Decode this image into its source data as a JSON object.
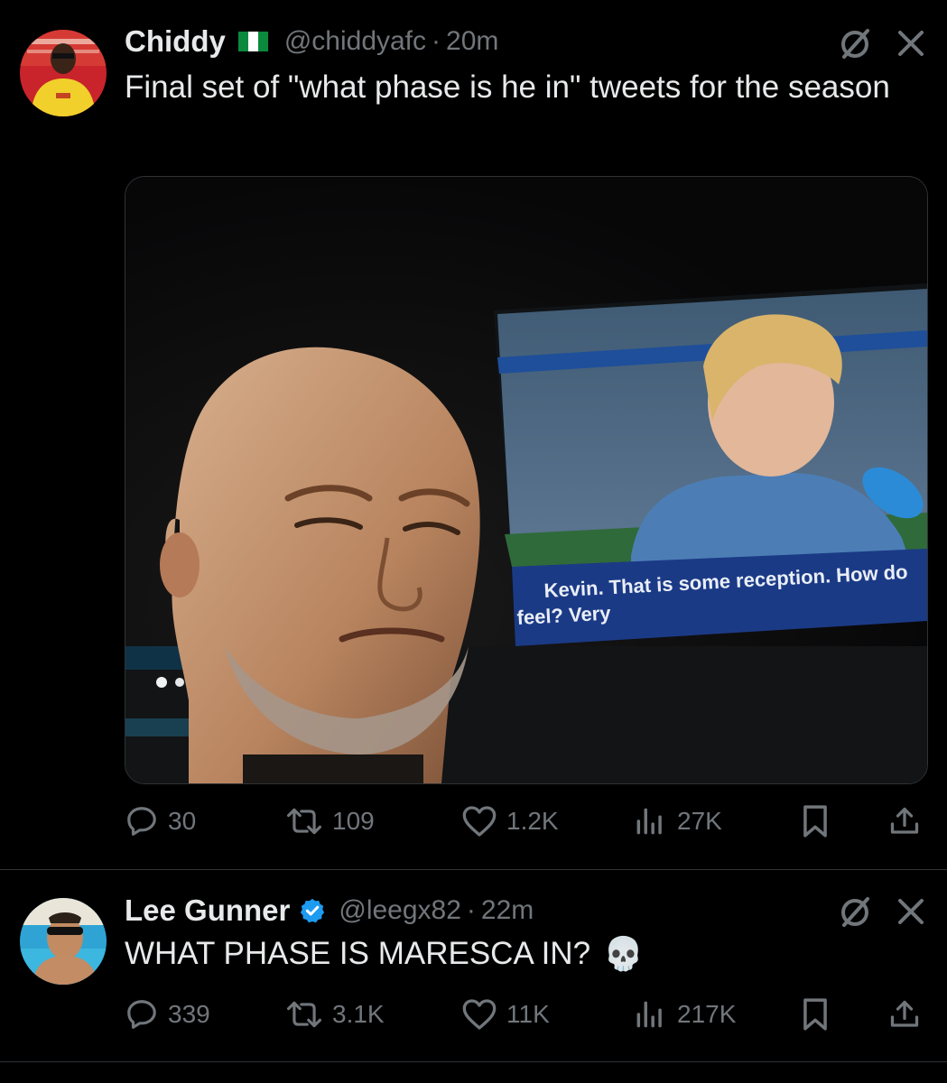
{
  "colors": {
    "background": "#000000",
    "text_primary": "#e7e9ea",
    "text_secondary": "#71767b",
    "divider": "#2f3336",
    "verified_blue": "#1d9bf0"
  },
  "tweets": [
    {
      "display_name": "Chiddy",
      "flag": "nigeria-flag",
      "handle": "@chiddyafc",
      "separator": "·",
      "time": "20m",
      "text": "Final set of \"what phase is he in\" tweets for the season",
      "media": {
        "caption_line1": "Kevin. That is some reception. How do",
        "caption_line2": "feel? Very"
      },
      "stats": {
        "replies": "30",
        "retweets": "109",
        "likes": "1.2K",
        "views": "27K"
      }
    },
    {
      "display_name": "Lee Gunner",
      "verified": true,
      "handle": "@leegx82",
      "separator": "·",
      "time": "22m",
      "text": "WHAT PHASE IS MARESCA IN?",
      "emoji": "💀",
      "stats": {
        "replies": "339",
        "retweets": "3.1K",
        "likes": "11K",
        "views": "217K"
      }
    }
  ]
}
